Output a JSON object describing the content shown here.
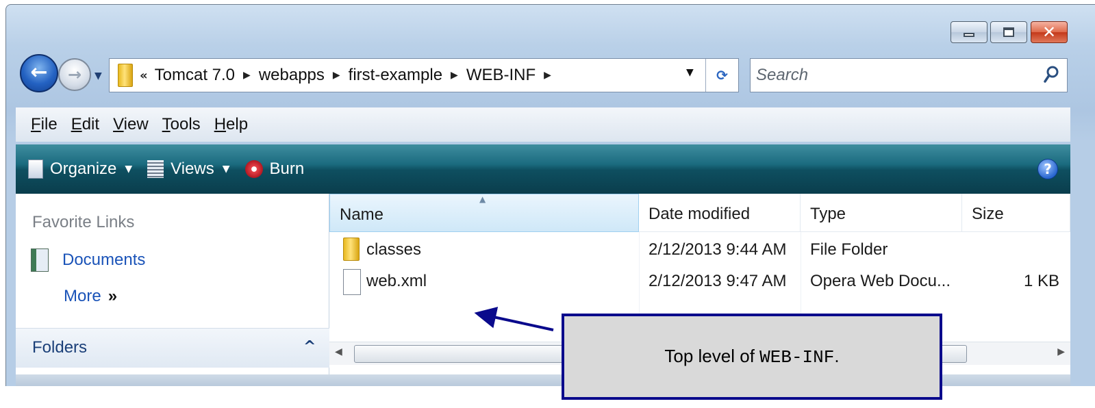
{
  "window": {
    "controls": {
      "minimize": "minimize",
      "maximize": "maximize",
      "close": "✕"
    }
  },
  "navigation": {
    "back_glyph": "←",
    "forward_glyph": "→",
    "address_overflow": "«",
    "breadcrumbs": [
      "Tomcat 7.0",
      "webapps",
      "first-example",
      "WEB-INF"
    ],
    "separator": "▶",
    "refresh_glyph": "⟳",
    "search_placeholder": "Search"
  },
  "menu": {
    "items": [
      {
        "accel": "F",
        "rest": "ile"
      },
      {
        "accel": "E",
        "rest": "dit"
      },
      {
        "accel": "V",
        "rest": "iew"
      },
      {
        "accel": "T",
        "rest": "ools"
      },
      {
        "accel": "H",
        "rest": "elp"
      }
    ]
  },
  "toolbar": {
    "organize": "Organize",
    "views": "Views",
    "burn": "Burn",
    "help": "?"
  },
  "nav_pane": {
    "favorite_links_title": "Favorite Links",
    "documents": "Documents",
    "more": "More",
    "more_chevron": "»",
    "folders": "Folders",
    "folders_chevron": "^"
  },
  "file_list": {
    "columns": [
      "Name",
      "Date modified",
      "Type",
      "Size"
    ],
    "rows": [
      {
        "name": "classes",
        "icon": "folder-icon",
        "date": "2/12/2013 9:44 AM",
        "type": "File Folder",
        "size": ""
      },
      {
        "name": "web.xml",
        "icon": "file-icon",
        "date": "2/12/2013 9:47 AM",
        "type": "Opera Web Docu...",
        "size": "1 KB"
      }
    ]
  },
  "callout": {
    "text_prefix": "Top level of ",
    "code": "WEB-INF",
    "text_suffix": "."
  },
  "colors": {
    "command_bar": "#0e4f60",
    "link": "#1a53b8",
    "callout_border": "#0a0a8c",
    "callout_fill": "#d9d9d9"
  }
}
